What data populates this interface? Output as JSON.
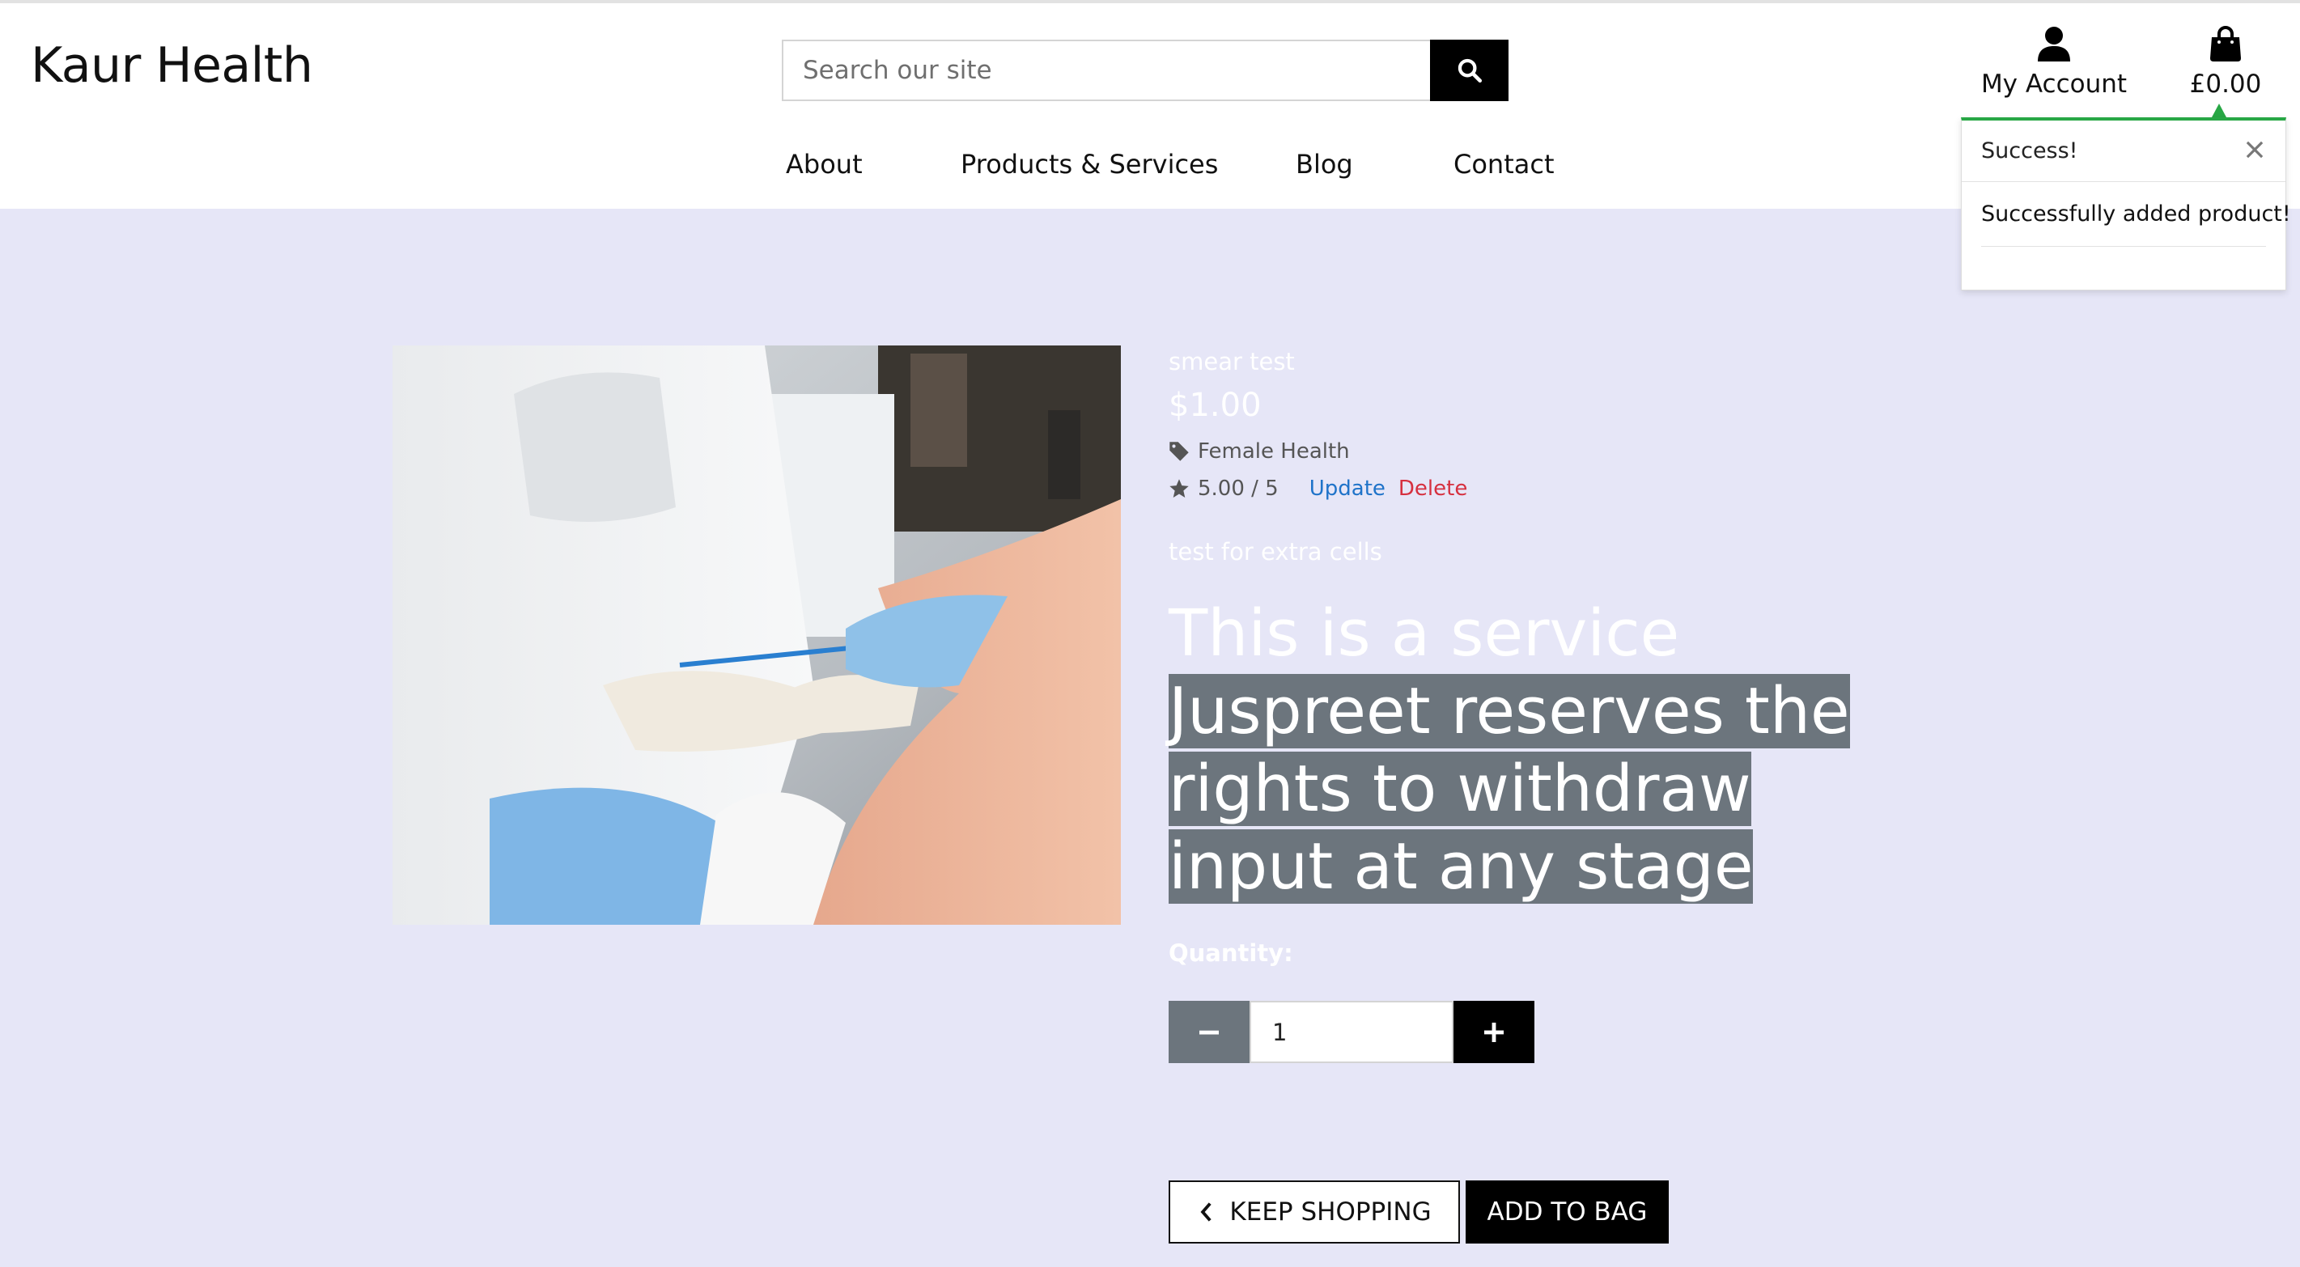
{
  "header": {
    "brand": "Kaur Health",
    "search": {
      "placeholder": "Search our site"
    },
    "account_label": "My Account",
    "bag_total": "£0.00"
  },
  "nav": {
    "items": [
      {
        "label": "About"
      },
      {
        "label": "Products & Services"
      },
      {
        "label": "Blog"
      },
      {
        "label": "Contact"
      }
    ]
  },
  "toast": {
    "title": "Success!",
    "message": "Successfully added product!",
    "status_color": "#28a745"
  },
  "product": {
    "name": "smear test",
    "price": "$1.00",
    "category": "Female Health",
    "rating": "5.00 / 5",
    "update_label": "Update",
    "delete_label": "Delete",
    "short_description": "test for extra cells",
    "long_description_plain": "This is a service ",
    "long_description_highlight": "Juspreet reserves the rights to withdraw input at any stage",
    "quantity_label": "Quantity:",
    "quantity_value": "1"
  },
  "actions": {
    "keep_shopping": "KEEP SHOPPING",
    "add_to_bag": "ADD TO BAG"
  },
  "colors": {
    "page_bg": "#e6e6f7",
    "link_blue": "#1f73c9",
    "delete_red": "#d6303f",
    "highlight_gray": "#6c757d"
  }
}
